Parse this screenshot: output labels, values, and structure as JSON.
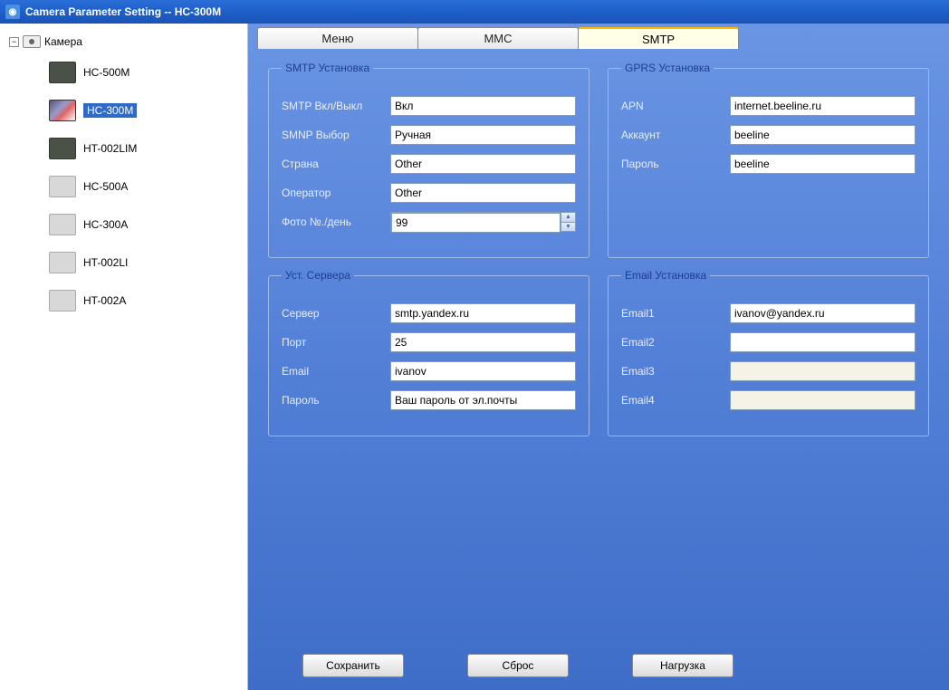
{
  "window": {
    "title": "Camera Parameter Setting -- HC-300M"
  },
  "tree": {
    "root": "Камера",
    "items": [
      {
        "label": "HC-500M",
        "thumb": "dark"
      },
      {
        "label": "HC-300M",
        "thumb": "mix",
        "selected": true
      },
      {
        "label": "HT-002LIM",
        "thumb": "dark"
      },
      {
        "label": "HC-500A",
        "thumb": "light"
      },
      {
        "label": "HC-300A",
        "thumb": "light"
      },
      {
        "label": "HT-002LI",
        "thumb": "light"
      },
      {
        "label": "HT-002A",
        "thumb": "light"
      }
    ]
  },
  "tabs": {
    "items": [
      "Меню",
      "MMC",
      "SMTP"
    ],
    "active": 2
  },
  "smtp": {
    "legend": "SMTP Установка",
    "on_off_label": "SMTP Вкл/Выкл",
    "on_off_value": "Вкл",
    "smnp_label": "SMNP Выбор",
    "smnp_value": "Ручная",
    "country_label": "Страна",
    "country_value": "Other",
    "operator_label": "Оператор",
    "operator_value": "Other",
    "photo_label": "Фото №./день",
    "photo_value": "99"
  },
  "gprs": {
    "legend": "GPRS Установка",
    "apn_label": "APN",
    "apn_value": "internet.beeline.ru",
    "account_label": "Аккаунт",
    "account_value": "beeline",
    "password_label": "Пароль",
    "password_value": "beeline"
  },
  "server": {
    "legend": "Уст. Сервера",
    "server_label": "Сервер",
    "server_value": "smtp.yandex.ru",
    "port_label": "Порт",
    "port_value": "25",
    "email_label": "Email",
    "email_value": "ivanov",
    "password_label": "Пароль",
    "password_value": "Ваш пароль от эл.почты"
  },
  "email": {
    "legend": "Email Установка",
    "e1_label": "Email1",
    "e1_value": "ivanov@yandex.ru",
    "e2_label": "Email2",
    "e2_value": "",
    "e3_label": "Email3",
    "e3_value": "",
    "e4_label": "Email4",
    "e4_value": ""
  },
  "buttons": {
    "save": "Сохранить",
    "reset": "Сброс",
    "load": "Нагрузка"
  }
}
